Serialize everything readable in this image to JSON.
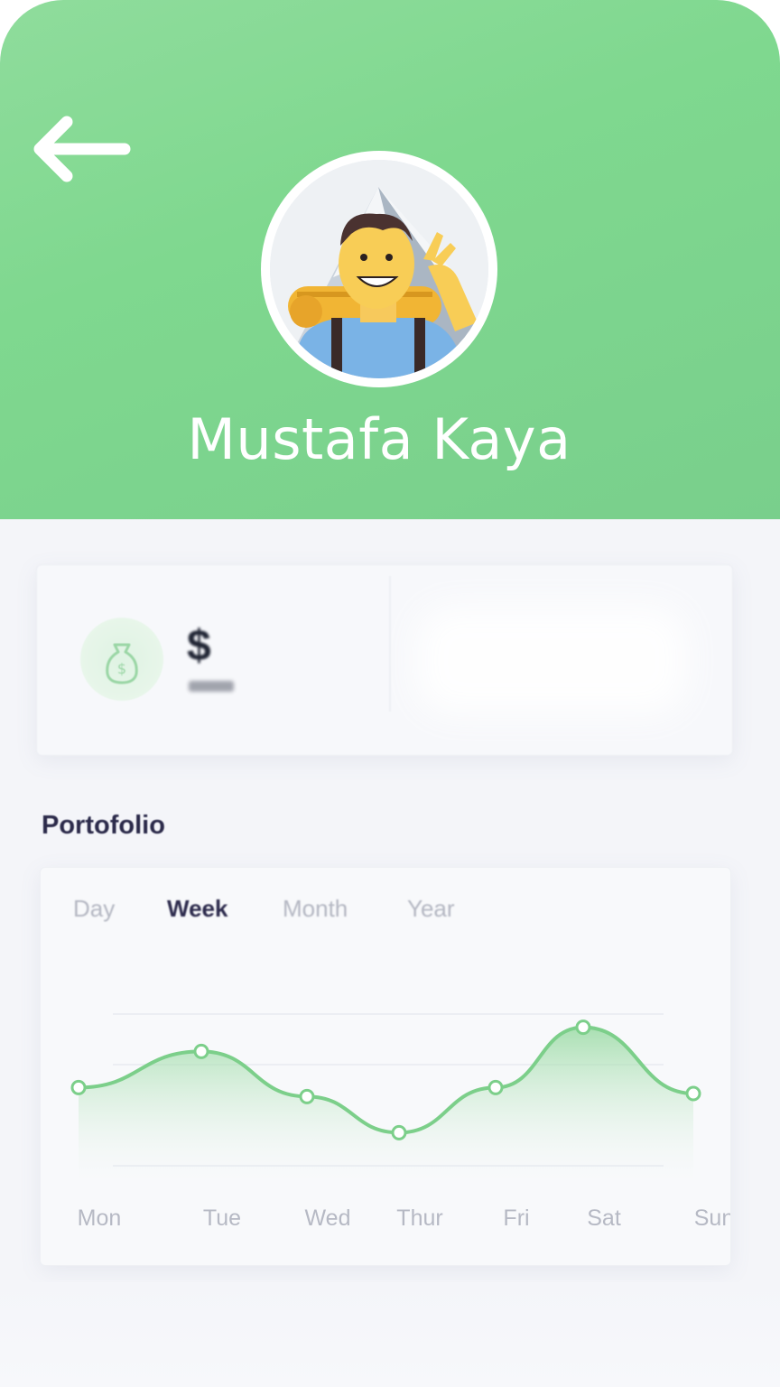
{
  "profile": {
    "name": "Mustafa Kaya"
  },
  "stats": {
    "balance_symbol": "$"
  },
  "portfolio": {
    "title": "Portofolio",
    "tabs": [
      "Day",
      "Week",
      "Month",
      "Year"
    ],
    "active_tab": "Week"
  },
  "colors": {
    "header_green": "#7fd88f",
    "line_green": "#7ccf8a",
    "title_dark": "#2b2a4a"
  },
  "icons": {
    "back": "arrow-left-icon",
    "money": "money-bag-icon"
  },
  "chart_data": {
    "type": "area",
    "categories": [
      "Mon",
      "Tue",
      "Wed",
      "Thur",
      "Fri",
      "Sat",
      "Sun"
    ],
    "values": [
      52,
      64,
      49,
      37,
      52,
      72,
      50
    ],
    "ylim": [
      20,
      80
    ],
    "grid": true,
    "title": "",
    "xlabel": "",
    "ylabel": ""
  }
}
